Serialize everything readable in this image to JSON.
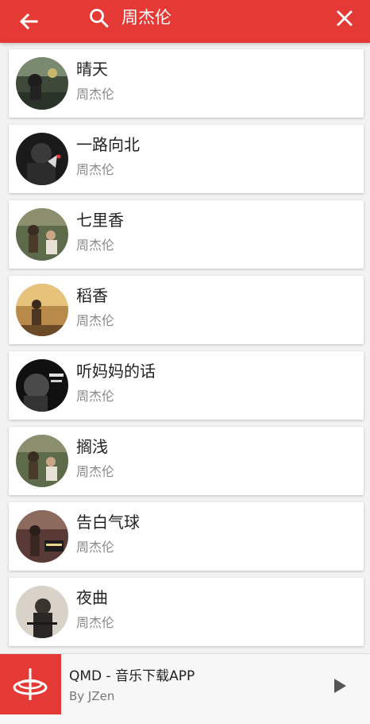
{
  "search": {
    "query": "周杰伦"
  },
  "icons": {
    "back": "arrow-left-icon",
    "search": "search-icon",
    "close": "close-icon",
    "play": "play-icon"
  },
  "colors": {
    "accent": "#e53935",
    "text_primary": "#222222",
    "text_secondary": "#8a8a8a"
  },
  "songs": [
    {
      "title": "晴天",
      "artist": "周杰伦"
    },
    {
      "title": "一路向北",
      "artist": "周杰伦"
    },
    {
      "title": "七里香",
      "artist": "周杰伦"
    },
    {
      "title": "稻香",
      "artist": "周杰伦"
    },
    {
      "title": "听妈妈的话",
      "artist": "周杰伦"
    },
    {
      "title": "搁浅",
      "artist": "周杰伦"
    },
    {
      "title": "告白气球",
      "artist": "周杰伦"
    },
    {
      "title": "夜曲",
      "artist": "周杰伦"
    }
  ],
  "player": {
    "title": "QMD - 音乐下载APP",
    "subtitle": "By JZen"
  }
}
